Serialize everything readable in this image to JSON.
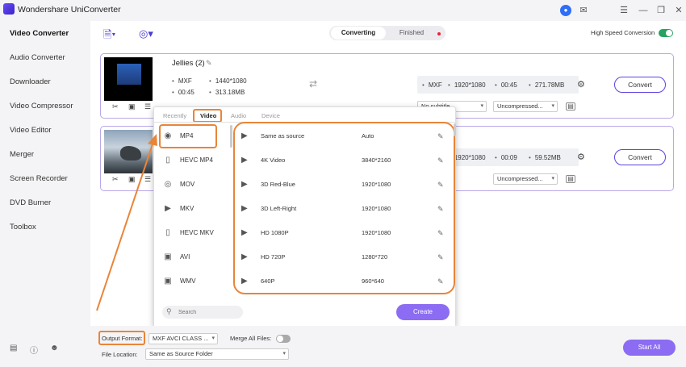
{
  "app": {
    "title": "Wondershare UniConverter"
  },
  "sidebar": {
    "items": [
      {
        "label": "Video Converter",
        "active": true
      },
      {
        "label": "Audio Converter"
      },
      {
        "label": "Downloader"
      },
      {
        "label": "Video Compressor"
      },
      {
        "label": "Video Editor"
      },
      {
        "label": "Merger"
      },
      {
        "label": "Screen Recorder"
      },
      {
        "label": "DVD Burner"
      },
      {
        "label": "Toolbox"
      }
    ]
  },
  "toolbar": {
    "tabs": [
      "Converting",
      "Finished"
    ],
    "hsc_label": "High Speed Conversion",
    "hsc_on": true
  },
  "files": [
    {
      "name": "Jellies (2)",
      "src": {
        "format": "MXF",
        "resolution": "1440*1080",
        "duration": "00:45",
        "size": "313.18MB"
      },
      "target": {
        "format": "MXF",
        "resolution": "1920*1080",
        "duration": "00:45",
        "size": "271.78MB"
      },
      "subtitle": "No subtitle",
      "audio": "Uncompressed...",
      "convert_label": "Convert"
    },
    {
      "name": "",
      "target": {
        "resolution": "1920*1080",
        "duration": "00:09",
        "size": "59.52MB"
      },
      "audio": "Uncompressed...",
      "convert_label": "Convert"
    }
  ],
  "format_popup": {
    "tabs": [
      "Recently",
      "Video",
      "Audio",
      "Device"
    ],
    "active_tab": "Video",
    "formats": [
      {
        "label": "MP4",
        "icon": "mp4-icon"
      },
      {
        "label": "HEVC MP4",
        "icon": "hevc-icon"
      },
      {
        "label": "MOV",
        "icon": "mov-icon"
      },
      {
        "label": "MKV",
        "icon": "mkv-icon"
      },
      {
        "label": "HEVC MKV",
        "icon": "hevc-icon"
      },
      {
        "label": "AVI",
        "icon": "avi-icon"
      },
      {
        "label": "WMV",
        "icon": "wmv-icon"
      }
    ],
    "resolutions": [
      {
        "name": "Same as source",
        "res": "Auto"
      },
      {
        "name": "4K Video",
        "res": "3840*2160"
      },
      {
        "name": "3D Red-Blue",
        "res": "1920*1080"
      },
      {
        "name": "3D Left-Right",
        "res": "1920*1080"
      },
      {
        "name": "HD 1080P",
        "res": "1920*1080"
      },
      {
        "name": "HD 720P",
        "res": "1280*720"
      },
      {
        "name": "640P",
        "res": "960*640"
      }
    ],
    "search_placeholder": "Search",
    "create_label": "Create"
  },
  "bottom": {
    "output_format_label": "Output Format:",
    "output_format_value": "MXF AVCI CLASS ...",
    "merge_label": "Merge All Files:",
    "merge_on": false,
    "file_location_label": "File Location:",
    "file_location_value": "Same as Source Folder",
    "start_all_label": "Start All"
  },
  "colors": {
    "accent": "#5b44e0",
    "highlight": "#e8853a",
    "button_fill": "#8b6cf2",
    "toggle_on": "#27a35f"
  }
}
